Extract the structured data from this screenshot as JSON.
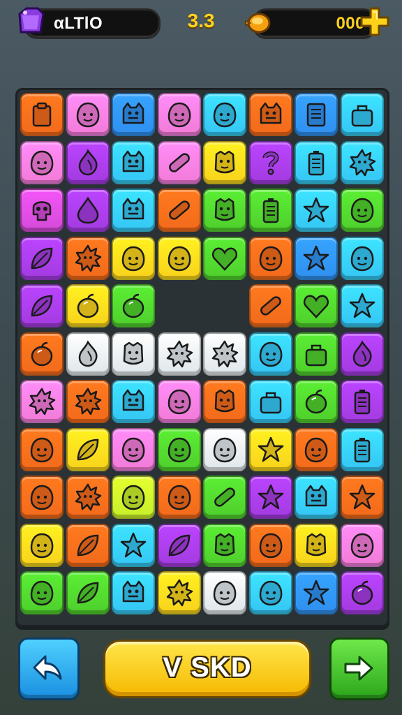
{
  "hud": {
    "gems_label": "αLTlO",
    "level_label": "3.3",
    "coins_label": "000"
  },
  "buttons": {
    "main_label": "V SKD"
  },
  "colors": {
    "orange": "#f26a1b",
    "pink": "#f27bd8",
    "blue": "#2f8fef",
    "cyan": "#35c6f4",
    "purple": "#a33be0",
    "green": "#4fcf2d",
    "yellow": "#f8d21c",
    "lime": "#c7ef2a",
    "red": "#e8452a",
    "white": "#dfe6ea",
    "magenta": "#d44ad8"
  },
  "board": {
    "rows": [
      [
        "orange:box",
        "pink:blob",
        "blue:monster",
        "pink:blob",
        "cyan:blob",
        "orange:monster",
        "blue:list",
        "cyan:bag"
      ],
      [
        "pink:blob",
        "purple:flame",
        "cyan:monster",
        "pink:tube",
        "yellow:face",
        "purple:question",
        "cyan:battery",
        "cyan:sun"
      ],
      [
        "magenta:skull",
        "purple:drop",
        "cyan:monster",
        "orange:tube",
        "green:face",
        "green:battery",
        "cyan:star",
        "green:blob"
      ],
      [
        "purple:leaf",
        "orange:sun",
        "yellow:blob",
        "yellow:blob",
        "green:heart",
        "orange:blob",
        "blue:star",
        "cyan:blob"
      ],
      [
        "purple:leaf",
        "yellow:fruit",
        "green:fruit",
        "empty",
        "empty",
        "orange:tube",
        "green:heart",
        "cyan:star"
      ],
      [
        "orange:fruit",
        "white:flame",
        "white:face",
        "white:sun",
        "white:sun",
        "cyan:blob",
        "green:bag",
        "purple:flame"
      ],
      [
        "pink:sun",
        "orange:sun",
        "cyan:monster",
        "pink:blob",
        "orange:face",
        "cyan:bag",
        "green:fruit",
        "purple:battery"
      ],
      [
        "orange:blob",
        "yellow:leaf",
        "pink:blob",
        "green:blob",
        "white:blob",
        "yellow:star",
        "orange:blob",
        "cyan:battery"
      ],
      [
        "orange:blob",
        "orange:sun",
        "lime:blob",
        "orange:blob",
        "green:tube",
        "purple:star",
        "cyan:monster",
        "orange:star"
      ],
      [
        "yellow:blob",
        "orange:leaf",
        "cyan:star",
        "purple:leaf",
        "green:face",
        "orange:blob",
        "yellow:face",
        "pink:blob"
      ],
      [
        "green:blob",
        "green:leaf",
        "cyan:monster",
        "yellow:sun",
        "white:blob",
        "cyan:blob",
        "blue:star",
        "purple:fruit"
      ]
    ]
  }
}
